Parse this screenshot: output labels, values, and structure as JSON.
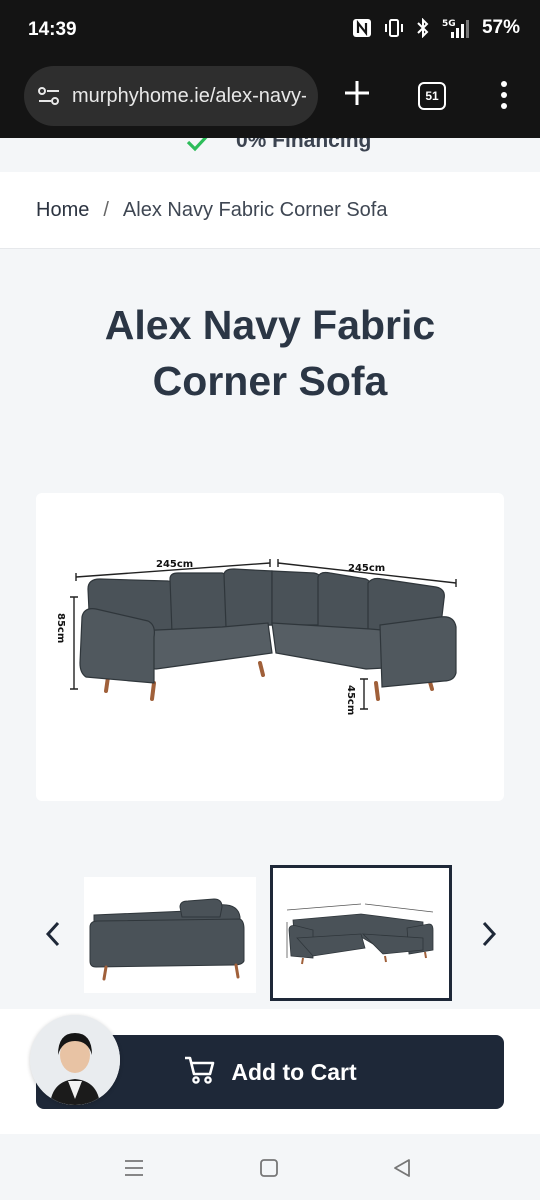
{
  "status_bar": {
    "time": "14:39",
    "battery": "57%",
    "icons": [
      "nfc-icon",
      "vibrate-icon",
      "bluetooth-icon",
      "5g-signal-icon"
    ],
    "network": "5G"
  },
  "browser": {
    "url": "murphyhome.ie/alex-navy-fabric-corner-sofa",
    "tab_count": "51",
    "icons": [
      "site-settings-icon",
      "new-tab-plus-icon",
      "tab-switcher-icon",
      "menu-dots-icon"
    ]
  },
  "promo": {
    "text": "0% Financing",
    "icon": "check-icon",
    "icon_color": "#2dbd5a"
  },
  "breadcrumb": {
    "home": "Home",
    "separator": "/",
    "current": "Alex Navy Fabric Corner Sofa"
  },
  "product": {
    "title": "Alex Navy Fabric Corner Sofa",
    "main_image": {
      "dim_width_left": "245cm",
      "dim_width_right": "245cm",
      "dim_height": "85cm",
      "dim_seat": "45cm"
    },
    "thumbnails": [
      {
        "name": "side-view",
        "selected": false
      },
      {
        "name": "dimensions-view",
        "selected": true
      }
    ],
    "prev_icon": "chevron-left-icon",
    "next_icon": "chevron-right-icon"
  },
  "cart": {
    "label": "Add to Cart",
    "icon": "cart-icon",
    "button_color": "#1e2838"
  },
  "chat": {
    "icon": "support-agent-avatar"
  },
  "nav": {
    "icons": [
      "recents-icon",
      "home-icon",
      "back-icon"
    ]
  }
}
